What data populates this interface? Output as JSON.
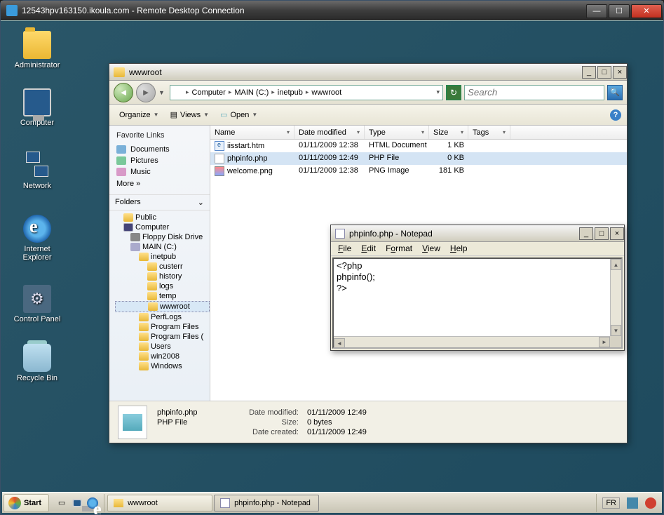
{
  "rdc": {
    "title": "12543hpv163150.ikoula.com - Remote Desktop Connection"
  },
  "desktop": {
    "icons": {
      "admin": "Administrator",
      "computer": "Computer",
      "network": "Network",
      "ie": "Internet Explorer",
      "cpanel": "Control Panel",
      "bin": "Recycle Bin"
    }
  },
  "explorer": {
    "title": "wwwroot",
    "breadcrumb": [
      "Computer",
      "MAIN (C:)",
      "inetpub",
      "wwwroot"
    ],
    "search_placeholder": "Search",
    "toolbar": {
      "organize": "Organize",
      "views": "Views",
      "open": "Open"
    },
    "favlinks": {
      "header": "Favorite Links",
      "items": [
        "Documents",
        "Pictures",
        "Music"
      ],
      "more": "More    »"
    },
    "folders_header": "Folders",
    "tree": [
      {
        "label": "Public",
        "indent": 0,
        "cls": ""
      },
      {
        "label": "Computer",
        "indent": 0,
        "cls": "comp"
      },
      {
        "label": "Floppy Disk Drive",
        "indent": 1,
        "cls": "flop"
      },
      {
        "label": "MAIN (C:)",
        "indent": 1,
        "cls": "drv"
      },
      {
        "label": "inetpub",
        "indent": 2,
        "cls": ""
      },
      {
        "label": "custerr",
        "indent": 3,
        "cls": ""
      },
      {
        "label": "history",
        "indent": 3,
        "cls": ""
      },
      {
        "label": "logs",
        "indent": 3,
        "cls": ""
      },
      {
        "label": "temp",
        "indent": 3,
        "cls": ""
      },
      {
        "label": "wwwroot",
        "indent": 3,
        "cls": "sel"
      },
      {
        "label": "PerfLogs",
        "indent": 2,
        "cls": ""
      },
      {
        "label": "Program Files",
        "indent": 2,
        "cls": ""
      },
      {
        "label": "Program Files (",
        "indent": 2,
        "cls": ""
      },
      {
        "label": "Users",
        "indent": 2,
        "cls": ""
      },
      {
        "label": "win2008",
        "indent": 2,
        "cls": ""
      },
      {
        "label": "Windows",
        "indent": 2,
        "cls": ""
      }
    ],
    "columns": {
      "name": "Name",
      "date": "Date modified",
      "type": "Type",
      "size": "Size",
      "tags": "Tags"
    },
    "files": [
      {
        "name": "iisstart.htm",
        "date": "01/11/2009 12:38",
        "type": "HTML Document",
        "size": "1 KB",
        "ico": "htm",
        "sel": false
      },
      {
        "name": "phpinfo.php",
        "date": "01/11/2009 12:49",
        "type": "PHP File",
        "size": "0 KB",
        "ico": "php",
        "sel": true
      },
      {
        "name": "welcome.png",
        "date": "01/11/2009 12:38",
        "type": "PNG Image",
        "size": "181 KB",
        "ico": "png",
        "sel": false
      }
    ],
    "details": {
      "filename": "phpinfo.php",
      "filetype": "PHP File",
      "date_modified_label": "Date modified:",
      "date_modified": "01/11/2009 12:49",
      "size_label": "Size:",
      "size": "0 bytes",
      "date_created_label": "Date created:",
      "date_created": "01/11/2009 12:49"
    }
  },
  "notepad": {
    "title": "phpinfo.php - Notepad",
    "menu": {
      "file": "File",
      "edit": "Edit",
      "format": "Format",
      "view": "View",
      "help": "Help"
    },
    "content": "<?php\nphpinfo();\n?>"
  },
  "taskbar": {
    "start": "Start",
    "tasks": [
      {
        "label": "wwwroot",
        "active": false,
        "ico": "folder"
      },
      {
        "label": "phpinfo.php - Notepad",
        "active": true,
        "ico": "txt"
      }
    ],
    "lang": "FR"
  }
}
